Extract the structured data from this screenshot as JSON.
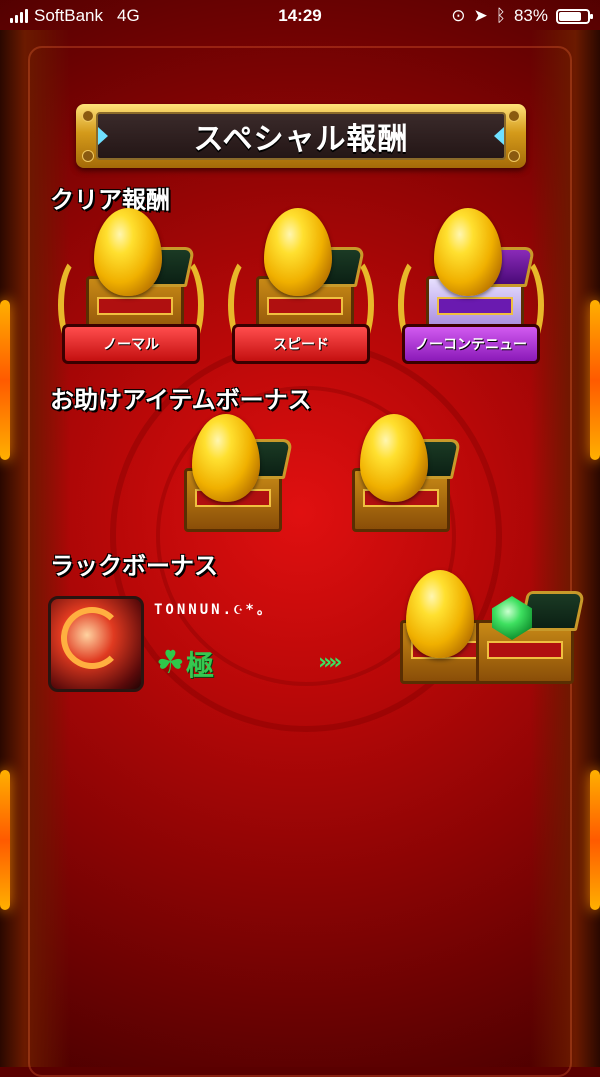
{
  "status_bar": {
    "carrier": "SoftBank",
    "network": "4G",
    "time": "14:29",
    "battery": "83%",
    "battery_level": 0.83
  },
  "banner": {
    "title": "スペシャル報酬"
  },
  "clear_reward": {
    "title": "クリア報酬",
    "items": [
      {
        "label": "ノーマル",
        "ribbon_color": "#d41a1a"
      },
      {
        "label": "スピード",
        "ribbon_color": "#d41a1a"
      },
      {
        "label": "ノーコンテニュー",
        "ribbon_color": "#9a24c8"
      }
    ]
  },
  "helper_bonus": {
    "title": "お助けアイテムボーナス"
  },
  "luck_bonus": {
    "title": "ラックボーナス",
    "player_name": "TONNUN.☪*。",
    "rank": "極",
    "rank_icon": "clover-icon",
    "arrow": "»»"
  },
  "colors": {
    "background": "#c00808",
    "gold": "#e8b82a",
    "luck_green": "#36c850"
  }
}
